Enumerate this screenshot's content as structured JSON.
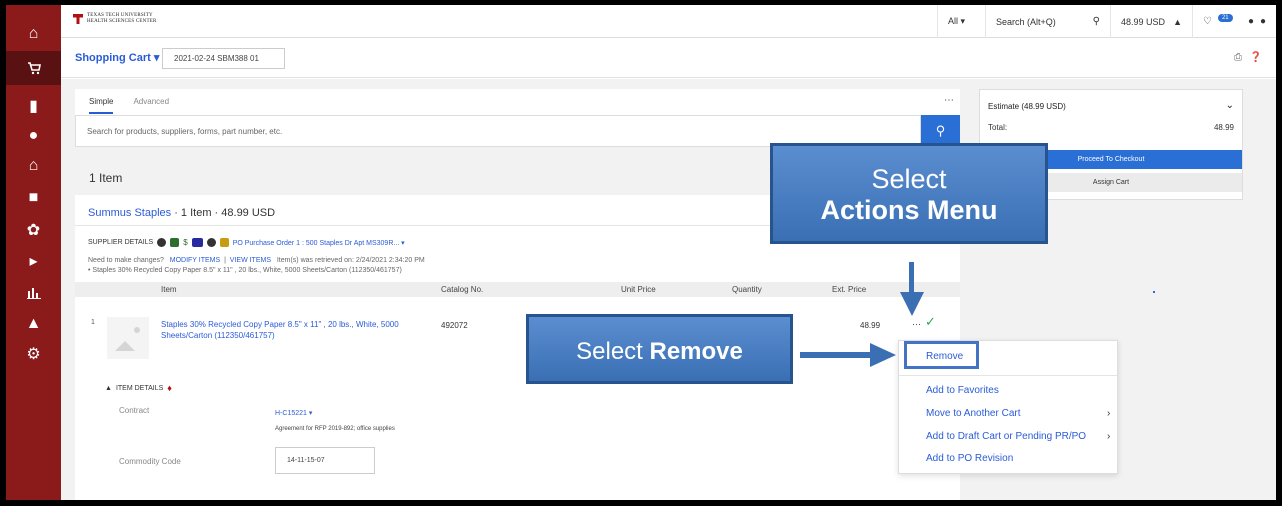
{
  "header": {
    "logo_line1": "TEXAS TECH UNIVERSITY",
    "logo_line2": "HEALTH SCIENCES CENTER",
    "search_scope": "All ▾",
    "search_placeholder": "Search (Alt+Q)",
    "cart_total": "48.99 USD",
    "notification_count": "21"
  },
  "subheader": {
    "title": "Shopping Cart ▾",
    "cart_name": "2021-02-24 SBM388 01"
  },
  "search": {
    "tabs": [
      "Simple",
      "Advanced"
    ],
    "placeholder": "Search for products, suppliers, forms, part number, etc."
  },
  "cart": {
    "item_count": "1 Item",
    "supplier_name": "Summus Staples",
    "supplier_meta": " · 1 Item · 48.99 USD",
    "supplier_details_label": "SUPPLIER DETAILS",
    "po_link": "PO Purchase Order 1 : 500 Staples Dr Apt MS309R... ▾",
    "need_changes": "Need to make changes?",
    "modify_items": "MODIFY ITEMS",
    "separator": "|",
    "view_items": "VIEW ITEMS",
    "retrieved": "Item(s) was retrieved on: 2/24/2021 2:34:20 PM",
    "bullet_item": "• Staples 30% Recycled Copy Paper 8.5\" x 11\" , 20 lbs., White, 5000 Sheets/Carton (112350/461757)",
    "columns": {
      "item": "Item",
      "catalog": "Catalog No.",
      "unit_price": "Unit Price",
      "quantity": "Quantity",
      "ext_price": "Ext. Price"
    },
    "row": {
      "num": "1",
      "title": "Staples 30% Recycled Copy Paper 8.5\" x 11\" , 20 lbs., White, 5000 Sheets/Carton (112350/461757)",
      "catalog_no": "492072",
      "ext_price": "48.99",
      "actions": "···"
    },
    "item_details_label": "ITEM DETAILS",
    "contract_label": "Contract",
    "contract_value": "H-C15221 ▾",
    "agreement": "Agreement for RFP 2019-892; office supplies",
    "commodity_label": "Commodity Code",
    "commodity_value": "14-11-15-07"
  },
  "estimate": {
    "title": "Estimate (48.99 USD)",
    "total_label": "Total:",
    "total_value": "48.99",
    "checkout": "Proceed To Checkout",
    "assign": "Assign Cart"
  },
  "actions_menu": {
    "items": [
      "Remove",
      "Add to Favorites",
      "Move to Another Cart",
      "Add to Draft Cart or Pending PR/PO",
      "Add to PO Revision"
    ]
  },
  "callouts": {
    "actions_line1": "Select",
    "actions_line2": "Actions Menu",
    "remove_prefix": "Select ",
    "remove_bold": "Remove"
  },
  "colors": {
    "sidebar": "#8b1a1a",
    "accent": "#2a6fd6",
    "link": "#2a5bd7",
    "callout": "#3a6fb4"
  }
}
